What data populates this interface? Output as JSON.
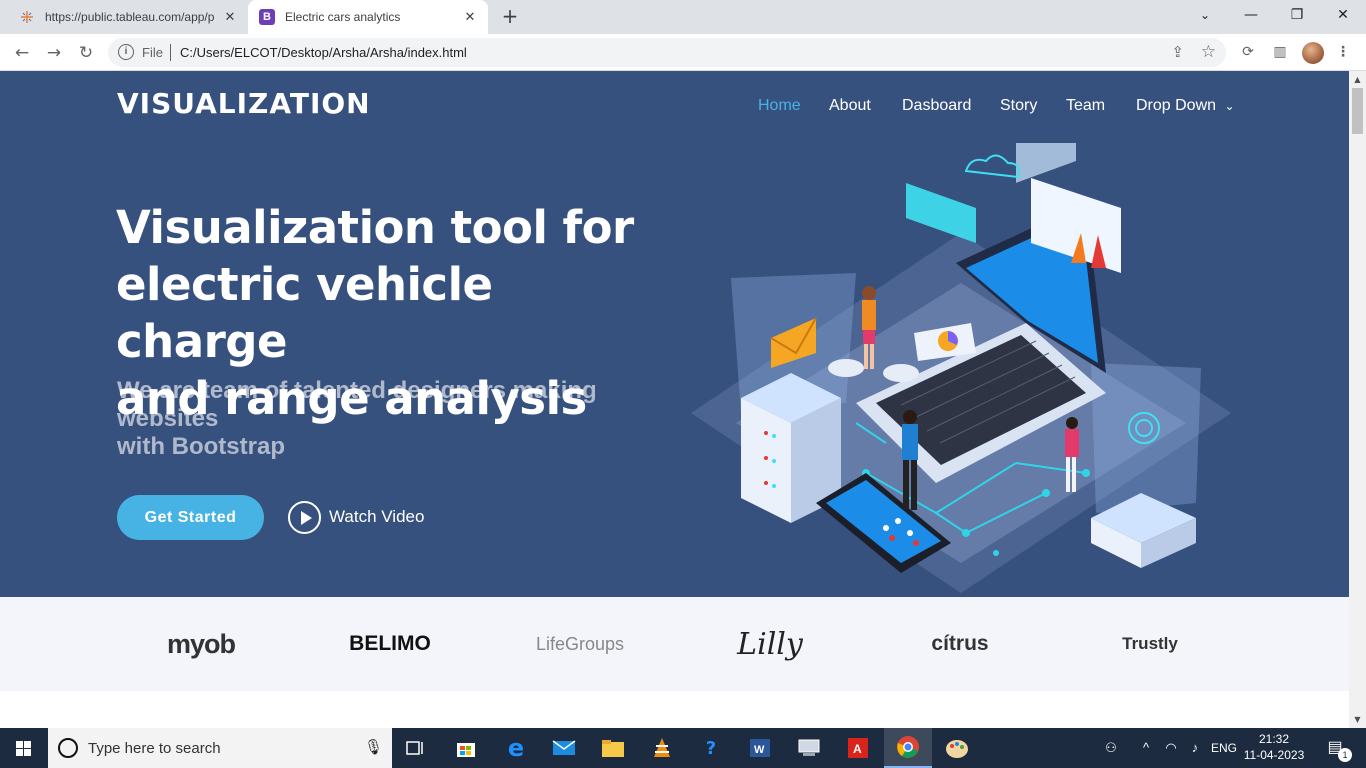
{
  "browser": {
    "tabs": [
      {
        "title": "https://public.tableau.com/app/p",
        "active": false
      },
      {
        "title": "Electric cars analytics",
        "active": true,
        "favicon_letter": "B"
      }
    ],
    "address": {
      "scheme_label": "File",
      "url": "C:/Users/ELCOT/Desktop/Arsha/Arsha/index.html"
    }
  },
  "site": {
    "logo": "VISUALIZATION",
    "nav": [
      {
        "label": "Home",
        "active": true
      },
      {
        "label": "About",
        "active": false
      },
      {
        "label": "Dasboard",
        "active": false
      },
      {
        "label": "Story",
        "active": false
      },
      {
        "label": "Team",
        "active": false
      },
      {
        "label": "Drop Down",
        "active": false
      }
    ],
    "hero": {
      "title_lines": [
        "Visualization tool for",
        "electric vehicle charge",
        "and range analysis"
      ],
      "subtitle_lines": [
        "We are team of talented designers making websites",
        "with Bootstrap"
      ],
      "cta_primary": "Get Started",
      "cta_secondary": "Watch Video"
    },
    "clients": [
      "myob",
      "BELIMO",
      "LifeGroups",
      "Lilly",
      "cítrus",
      "Trustly"
    ]
  },
  "taskbar": {
    "search_placeholder": "Type here to search",
    "language": "ENG",
    "time": "21:32",
    "date": "11-04-2023",
    "notification_count": "1"
  },
  "colors": {
    "hero_bg": "#37517e",
    "accent": "#47b2e4",
    "clients_bg": "#f3f5fa",
    "taskbar_bg": "#1c2b3f"
  }
}
